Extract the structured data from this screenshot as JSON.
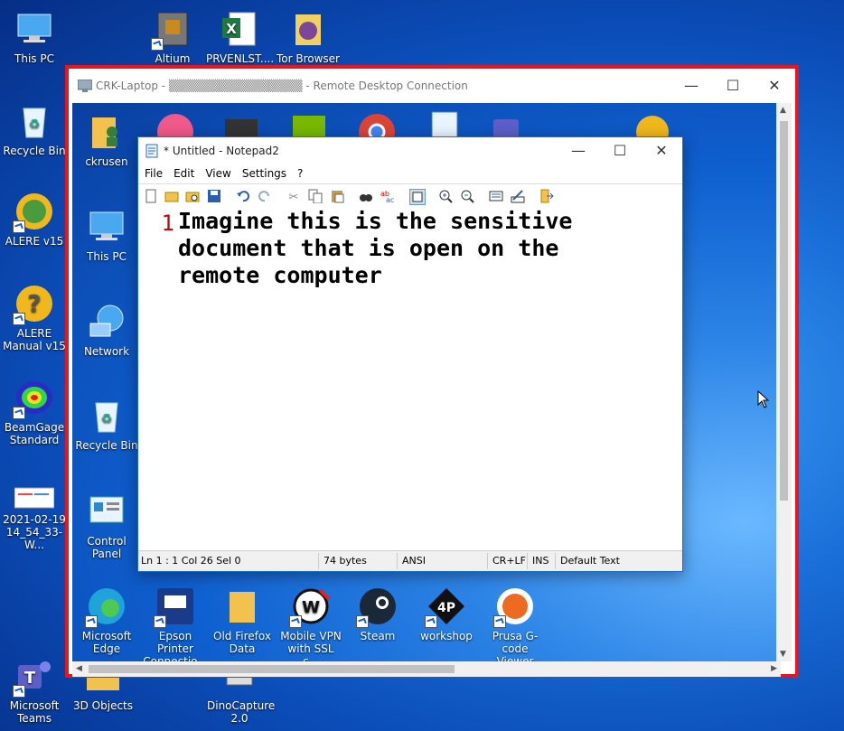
{
  "desktop": {
    "icons": [
      {
        "label": "This PC"
      },
      {
        "label": "Recycle Bin"
      },
      {
        "label": "ALERE v15"
      },
      {
        "label": "ALERE Manual v15"
      },
      {
        "label": "BeamGage Standard"
      },
      {
        "label": "2021-02-19 14_54_33-W..."
      },
      {
        "label": "Microsoft Teams"
      },
      {
        "label": "Altium"
      },
      {
        "label": "PRVENLST...."
      },
      {
        "label": "Tor Browser"
      },
      {
        "label": "3D Objects"
      },
      {
        "label": "DinoCapture 2.0"
      }
    ]
  },
  "rdc": {
    "title": "CRK-Laptop - ▒▒▒▒▒▒▒▒▒▒▒▒▒▒▒▒ - Remote Desktop Connection",
    "minimize": "—",
    "maximize": "☐",
    "close": "✕"
  },
  "remote": {
    "left_icons": [
      {
        "label": "ckrusen"
      },
      {
        "label": "This PC"
      },
      {
        "label": "Network"
      },
      {
        "label": "Recycle Bin"
      },
      {
        "label": "Control Panel"
      }
    ],
    "bottom_icons": [
      {
        "label": "Microsoft Edge"
      },
      {
        "label": "Epson Printer Connectio..."
      },
      {
        "label": "Old Firefox Data"
      },
      {
        "label": "Mobile VPN with SSL c..."
      },
      {
        "label": "Steam"
      },
      {
        "label": "workshop"
      },
      {
        "label": "Prusa G-code Viewer"
      }
    ]
  },
  "notepad": {
    "title": "* Untitled - Notepad2",
    "menu": [
      "File",
      "Edit",
      "View",
      "Settings",
      "?"
    ],
    "line_number": "1",
    "content": "Imagine this is the sensitive document that is open on the remote computer",
    "status": {
      "position": "Ln 1 : 1   Col 26   Sel 0",
      "size": "74 bytes",
      "encoding": "ANSI",
      "eol": "CR+LF",
      "mode": "INS",
      "scheme": "Default Text"
    }
  },
  "colors": {
    "border": "#e8141e",
    "accent": "#1a6bd3",
    "line_number": "#d20000"
  }
}
